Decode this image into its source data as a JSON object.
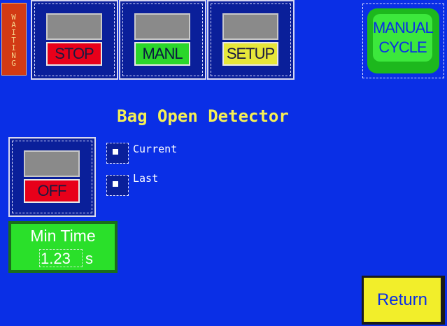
{
  "status": {
    "text": "WAITING"
  },
  "mode_buttons": [
    {
      "label": "STOP",
      "color": "#e8001a"
    },
    {
      "label": "MANL",
      "color": "#2bd62b"
    },
    {
      "label": "SETUP",
      "color": "#e6e63a"
    }
  ],
  "manual_cycle": {
    "line1": "MANUAL",
    "line2": "CYCLE"
  },
  "title": "Bag Open Detector",
  "detector": {
    "state_label": "OFF"
  },
  "indicators": [
    {
      "label": "Current"
    },
    {
      "label": "Last"
    }
  ],
  "min_time": {
    "label": "Min Time",
    "value": "1.23",
    "unit": "s"
  },
  "return": {
    "label": "Return"
  }
}
